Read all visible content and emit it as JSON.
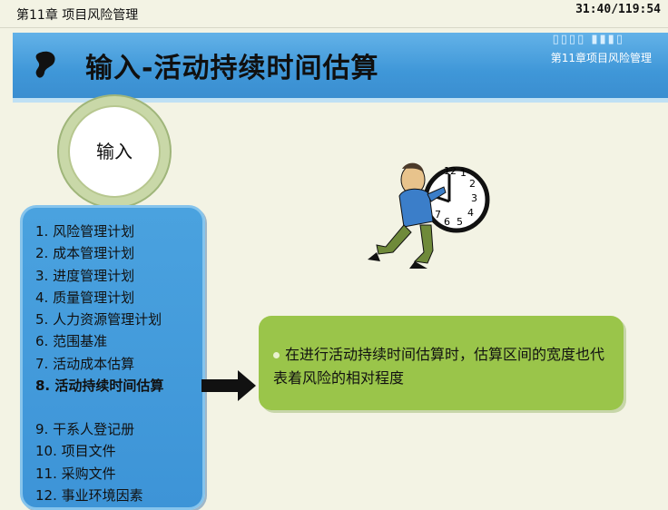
{
  "topbar": {
    "chapter": "第11章 项目风险管理",
    "timer": "31:40/119:54"
  },
  "banner": {
    "title": "输入-活动持续时间估算",
    "subtitle": "第11章项目风险管理"
  },
  "circle": {
    "label": "输入"
  },
  "inputs": [
    "1. 风险管理计划",
    "2. 成本管理计划",
    "3. 进度管理计划",
    "4. 质量管理计划",
    "5. 人力资源管理计划",
    "6. 范围基准",
    "7. 活动成本估算",
    "8. 活动持续时间估算",
    "9. 干系人登记册",
    "10. 项目文件",
    "11. 采购文件",
    "12. 事业环境因素"
  ],
  "note": {
    "text": "在进行活动持续时间估算时，估算区间的宽度也代表着风险的相对程度"
  },
  "clock": {
    "numbers": [
      "12",
      "1",
      "2",
      "3",
      "4",
      "5",
      "6",
      "7"
    ]
  },
  "colors": {
    "banner": "#3f97d8",
    "green_box": "#9ac54a",
    "list_box": "#4aa2df"
  }
}
